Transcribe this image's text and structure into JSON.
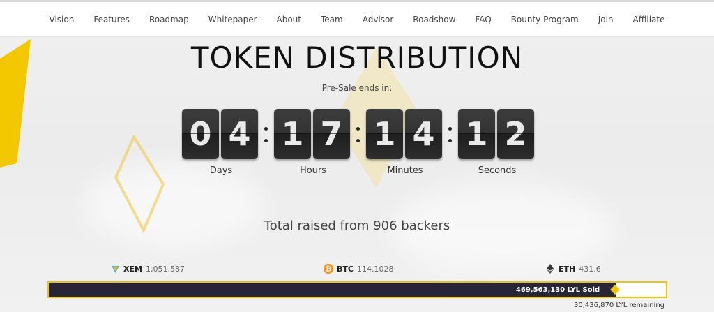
{
  "nav": {
    "items": [
      {
        "label": "Vision"
      },
      {
        "label": "Features"
      },
      {
        "label": "Roadmap"
      },
      {
        "label": "Whitepaper"
      },
      {
        "label": "About"
      },
      {
        "label": "Team"
      },
      {
        "label": "Advisor"
      },
      {
        "label": "Roadshow"
      },
      {
        "label": "FAQ"
      },
      {
        "label": "Bounty Program"
      },
      {
        "label": "Join"
      },
      {
        "label": "Affiliate"
      }
    ]
  },
  "hero": {
    "title": "TOKEN DISTRIBUTION",
    "presale_text": "Pre-Sale ends in:"
  },
  "countdown": {
    "days": {
      "d1": "0",
      "d2": "4",
      "label": "Days"
    },
    "hours": {
      "d1": "1",
      "d2": "7",
      "label": "Hours"
    },
    "minutes": {
      "d1": "1",
      "d2": "4",
      "label": "Minutes"
    },
    "seconds": {
      "d1": "1",
      "d2": "2",
      "label": "Seconds"
    }
  },
  "raised": {
    "text": "Total raised from 906 backers"
  },
  "crypto": {
    "xem": {
      "name": "XEM",
      "amount": "1,051,587",
      "icon": "xem-icon"
    },
    "btc": {
      "name": "BTC",
      "amount": "114.1028",
      "icon": "btc-icon"
    },
    "eth": {
      "name": "ETH",
      "amount": "431.6",
      "icon": "eth-icon"
    }
  },
  "progress": {
    "sold_label": "469,563,130 LYL Sold",
    "remaining_label": "30,436,870 LYL remaining",
    "fraction": 0.92
  },
  "colors": {
    "accent": "#f3c300",
    "bar": "#262637",
    "digit": "#333333"
  }
}
